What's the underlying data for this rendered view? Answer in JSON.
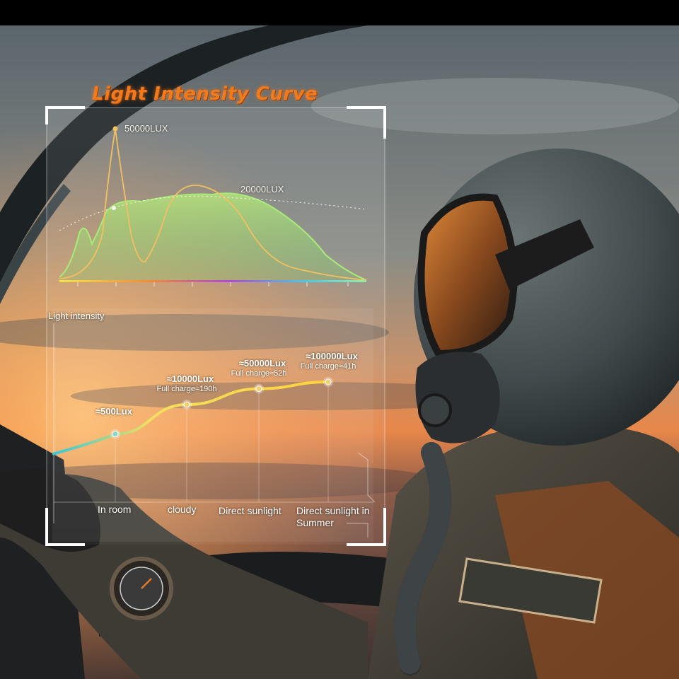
{
  "title": "Light Intensity Curve",
  "upper_chart": {
    "peak_labels": [
      "50000LUX",
      "20000LUX"
    ]
  },
  "lower_chart": {
    "y_title": "Light intensity"
  },
  "chart_data": [
    {
      "type": "line",
      "title": "Light Intensity Curve",
      "series": [
        {
          "name": "",
          "values": [],
          "annotation": "50000LUX",
          "color": "#f2b94a"
        },
        {
          "name": "",
          "values": [],
          "annotation": "20000LUX",
          "color": "#9be07a"
        }
      ],
      "grid": false
    },
    {
      "type": "line",
      "ylabel": "Light intensity",
      "categories": [
        "In room",
        "cloudy",
        "Direct sunlight",
        "Direct sunlight in Summer"
      ],
      "points": [
        {
          "category": "In room",
          "lux": "≈500Lux",
          "charge": "",
          "value": 500
        },
        {
          "category": "cloudy",
          "lux": "≈10000Lux",
          "charge": "Full charge≈190h",
          "value": 10000
        },
        {
          "category": "Direct sunlight",
          "lux": "≈50000Lux",
          "charge": "Full charge≈52h",
          "value": 50000
        },
        {
          "category": "Direct sunlight in Summer",
          "lux": "≈100000Lux",
          "charge": "Full charge≈41h",
          "value": 100000
        }
      ],
      "grid": false
    }
  ],
  "colors": {
    "title": "#f07a1e",
    "curve_low": "#38c8d6",
    "curve_high": "#ffd23c",
    "frame": "#ffffff"
  }
}
